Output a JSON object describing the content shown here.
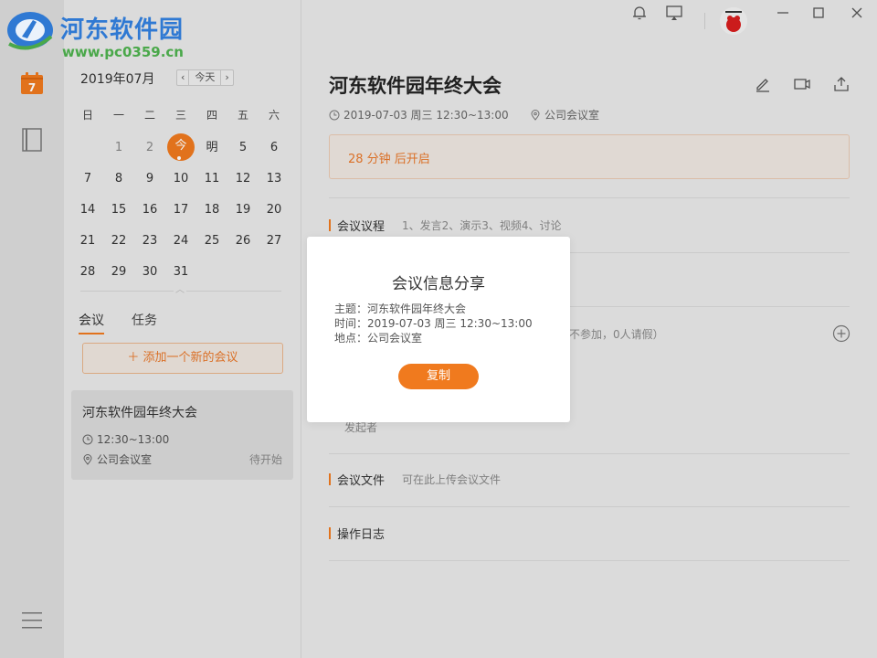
{
  "branding": {
    "site_name": "河东软件园",
    "site_url": "www.pc0359.cn"
  },
  "rail": {
    "calendar_day": "7"
  },
  "calendar": {
    "month_label": "2019年07月",
    "prev": "‹",
    "today_btn": "今天",
    "next": "›",
    "weekdays": [
      "日",
      "一",
      "二",
      "三",
      "四",
      "五",
      "六"
    ],
    "weeks": [
      [
        "",
        "1",
        "2",
        "今",
        "明",
        "5",
        "6"
      ],
      [
        "7",
        "8",
        "9",
        "10",
        "11",
        "12",
        "13"
      ],
      [
        "14",
        "15",
        "16",
        "17",
        "18",
        "19",
        "20"
      ],
      [
        "21",
        "22",
        "23",
        "24",
        "25",
        "26",
        "27"
      ],
      [
        "28",
        "29",
        "30",
        "31",
        "",
        "",
        ""
      ]
    ]
  },
  "sidebar": {
    "tabs": [
      "会议",
      "任务"
    ],
    "add_meeting": "＋  添加一个新的会议",
    "meeting_card": {
      "title": "河东软件园年终大会",
      "time": "12:30~13:00",
      "place": "公司会议室",
      "status": "待开始"
    }
  },
  "main": {
    "title": "河东软件园年终大会",
    "datetime": "2019-07-03 周三 12:30~13:00",
    "place": "公司会议室",
    "notice": "28 分钟 后开启",
    "sections": {
      "agenda_label": "会议议程",
      "agenda_desc": "1、发言2、演示3、视频4、讨论",
      "participants_partial": "不参加，0人请假）",
      "initiator": "发起者",
      "files_label": "会议文件",
      "files_desc": "可在此上传会议文件",
      "log_label": "操作日志"
    }
  },
  "modal": {
    "title": "会议信息分享",
    "topic": "主题：河东软件园年终大会",
    "time": "时间：2019-07-03 周三 12:30~13:00",
    "place": "地点：公司会议室",
    "copy_button": "复制"
  },
  "colors": {
    "accent": "#f07a1e",
    "brand_blue": "#2f79d3",
    "brand_green": "#4aa84a"
  }
}
